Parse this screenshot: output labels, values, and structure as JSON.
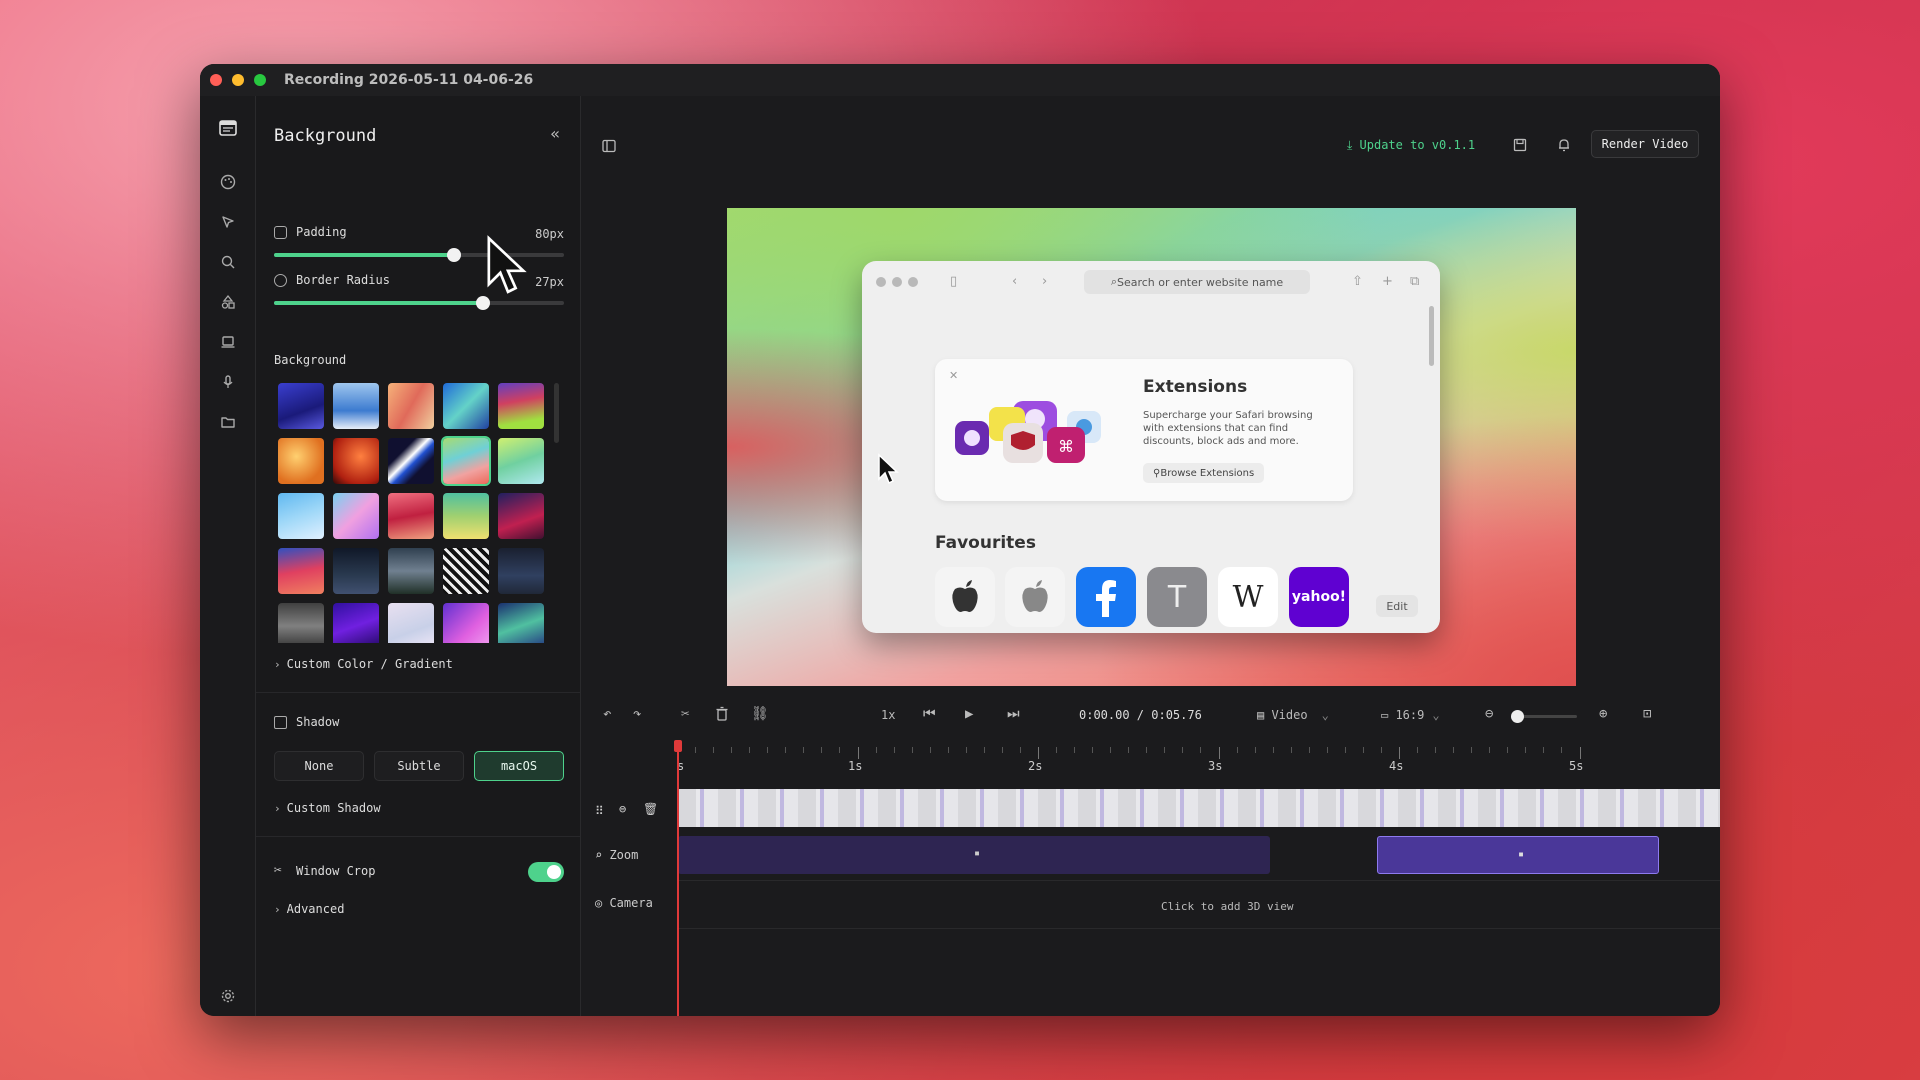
{
  "window": {
    "title": "Recording 2026-05-11 04-06-26"
  },
  "panel": {
    "title": "Background",
    "padding": {
      "label": "Padding",
      "value": "80px",
      "fraction": 0.62
    },
    "border_radius": {
      "label": "Border Radius",
      "value": "27px",
      "fraction": 0.72
    },
    "background_label": "Background",
    "custom_color": "Custom Color / Gradient",
    "shadow": {
      "label": "Shadow",
      "options": [
        "None",
        "Subtle",
        "macOS"
      ],
      "selected": "macOS"
    },
    "custom_shadow": "Custom Shadow",
    "window_crop": {
      "label": "Window Crop",
      "enabled": true
    },
    "advanced": "Advanced"
  },
  "topbar": {
    "update": "Update to v0.1.1",
    "render": "Render Video"
  },
  "browser": {
    "search_placeholder": "Search or enter website name",
    "ext_title": "Extensions",
    "ext_desc": "Supercharge your Safari browsing with extensions that can find discounts, block ads and more.",
    "ext_button": "Browse Extensions",
    "fav_title": "Favourites",
    "fav_tiles": [
      "T",
      "W",
      "yahoo!"
    ],
    "edit": "Edit"
  },
  "controls": {
    "speed": "1x",
    "time": "0:00.00 / 0:05.76",
    "view": "Video",
    "aspect": "16:9"
  },
  "ruler": {
    "labels": [
      "s",
      "1s",
      "2s",
      "3s",
      "4s",
      "5s"
    ]
  },
  "tracks": {
    "zoom": "Zoom",
    "camera": "Camera",
    "camera_hint": "Click to add 3D view"
  }
}
